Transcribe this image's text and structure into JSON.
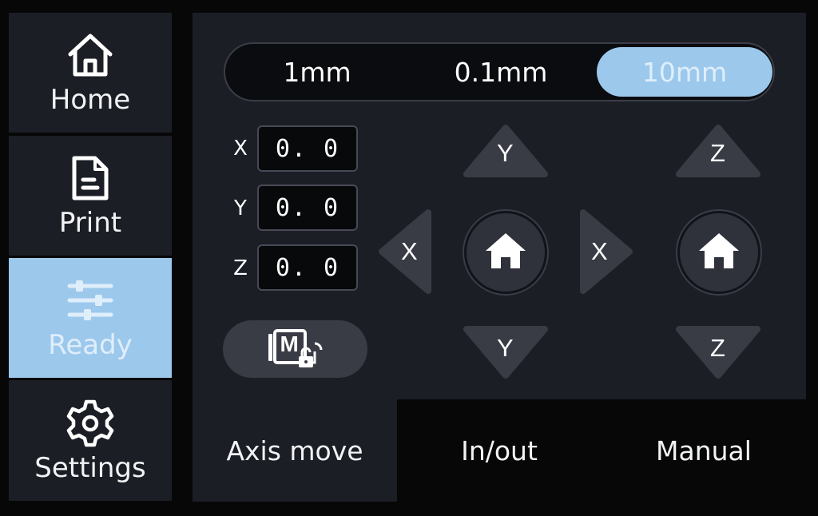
{
  "sidebar": {
    "items": [
      {
        "label": "Home",
        "icon": "home-icon"
      },
      {
        "label": "Print",
        "icon": "file-icon"
      },
      {
        "label": "Ready",
        "icon": "sliders-icon",
        "active": true
      },
      {
        "label": "Settings",
        "icon": "gear-icon"
      }
    ]
  },
  "step_sizes": {
    "options": [
      "1mm",
      "0.1mm",
      "10mm"
    ],
    "selected": "10mm"
  },
  "coordinates": [
    {
      "axis": "X",
      "value": "0. 0"
    },
    {
      "axis": "Y",
      "value": "0. 0"
    },
    {
      "axis": "Z",
      "value": "0. 0"
    }
  ],
  "unlock_button": {
    "icon": "motor-unlock-icon",
    "glyph": "M"
  },
  "jog": {
    "y_plus": "Y",
    "y_minus": "Y",
    "x_minus": "X",
    "x_plus": "X",
    "z_plus": "Z",
    "z_minus": "Z",
    "home_icon": "home-icon"
  },
  "tabs": [
    {
      "label": "Axis move",
      "active": true
    },
    {
      "label": "In/out"
    },
    {
      "label": "Manual"
    }
  ],
  "colors": {
    "accent": "#9cc8ec",
    "panel": "#1c1e26",
    "background": "#070708",
    "control": "#393c45"
  }
}
